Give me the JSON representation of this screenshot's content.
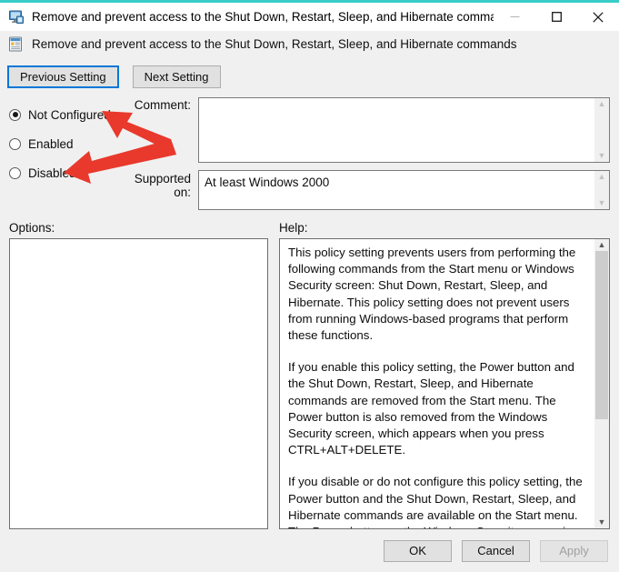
{
  "window": {
    "title": "Remove and prevent access to the Shut Down, Restart, Sleep, and Hibernate comman...",
    "icon": "policy-monitor-icon",
    "accent_color": "#38cdc9",
    "minimize_label": "—",
    "maximize_label": "□",
    "close_label": "✕"
  },
  "header": {
    "icon": "policy-setting-icon",
    "title": "Remove and prevent access to the Shut Down, Restart, Sleep, and Hibernate commands"
  },
  "nav": {
    "previous_label": "Previous Setting",
    "next_label": "Next Setting"
  },
  "state_options": [
    {
      "label": "Not Configured",
      "selected": true
    },
    {
      "label": "Enabled",
      "selected": false
    },
    {
      "label": "Disabled",
      "selected": false
    }
  ],
  "comment": {
    "label": "Comment:",
    "value": "",
    "placeholder": ""
  },
  "supported_on": {
    "label": "Supported on:",
    "value": "At least Windows 2000"
  },
  "panels": {
    "options_label": "Options:",
    "options_content": "",
    "help_label": "Help:",
    "help_paragraphs": [
      "This policy setting prevents users from performing the following commands from the Start menu or Windows Security screen: Shut Down, Restart, Sleep, and Hibernate. This policy setting does not prevent users from running Windows-based programs that perform these functions.",
      "If you enable this policy setting, the Power button and the Shut Down, Restart, Sleep, and Hibernate commands are removed from the Start menu. The Power button is also removed from the Windows Security screen, which appears when you press CTRL+ALT+DELETE.",
      "If you disable or do not configure this policy setting, the Power button and the Shut Down, Restart, Sleep, and Hibernate commands are available on the Start menu. The Power button on the Windows Security screen is also available."
    ]
  },
  "footer": {
    "ok_label": "OK",
    "cancel_label": "Cancel",
    "apply_label": "Apply",
    "apply_disabled": true
  },
  "annotations": {
    "arrow_color": "#e8392c",
    "description": "Red double-headed chevron arrow pointing at the Not Configured and Disabled radio options"
  }
}
